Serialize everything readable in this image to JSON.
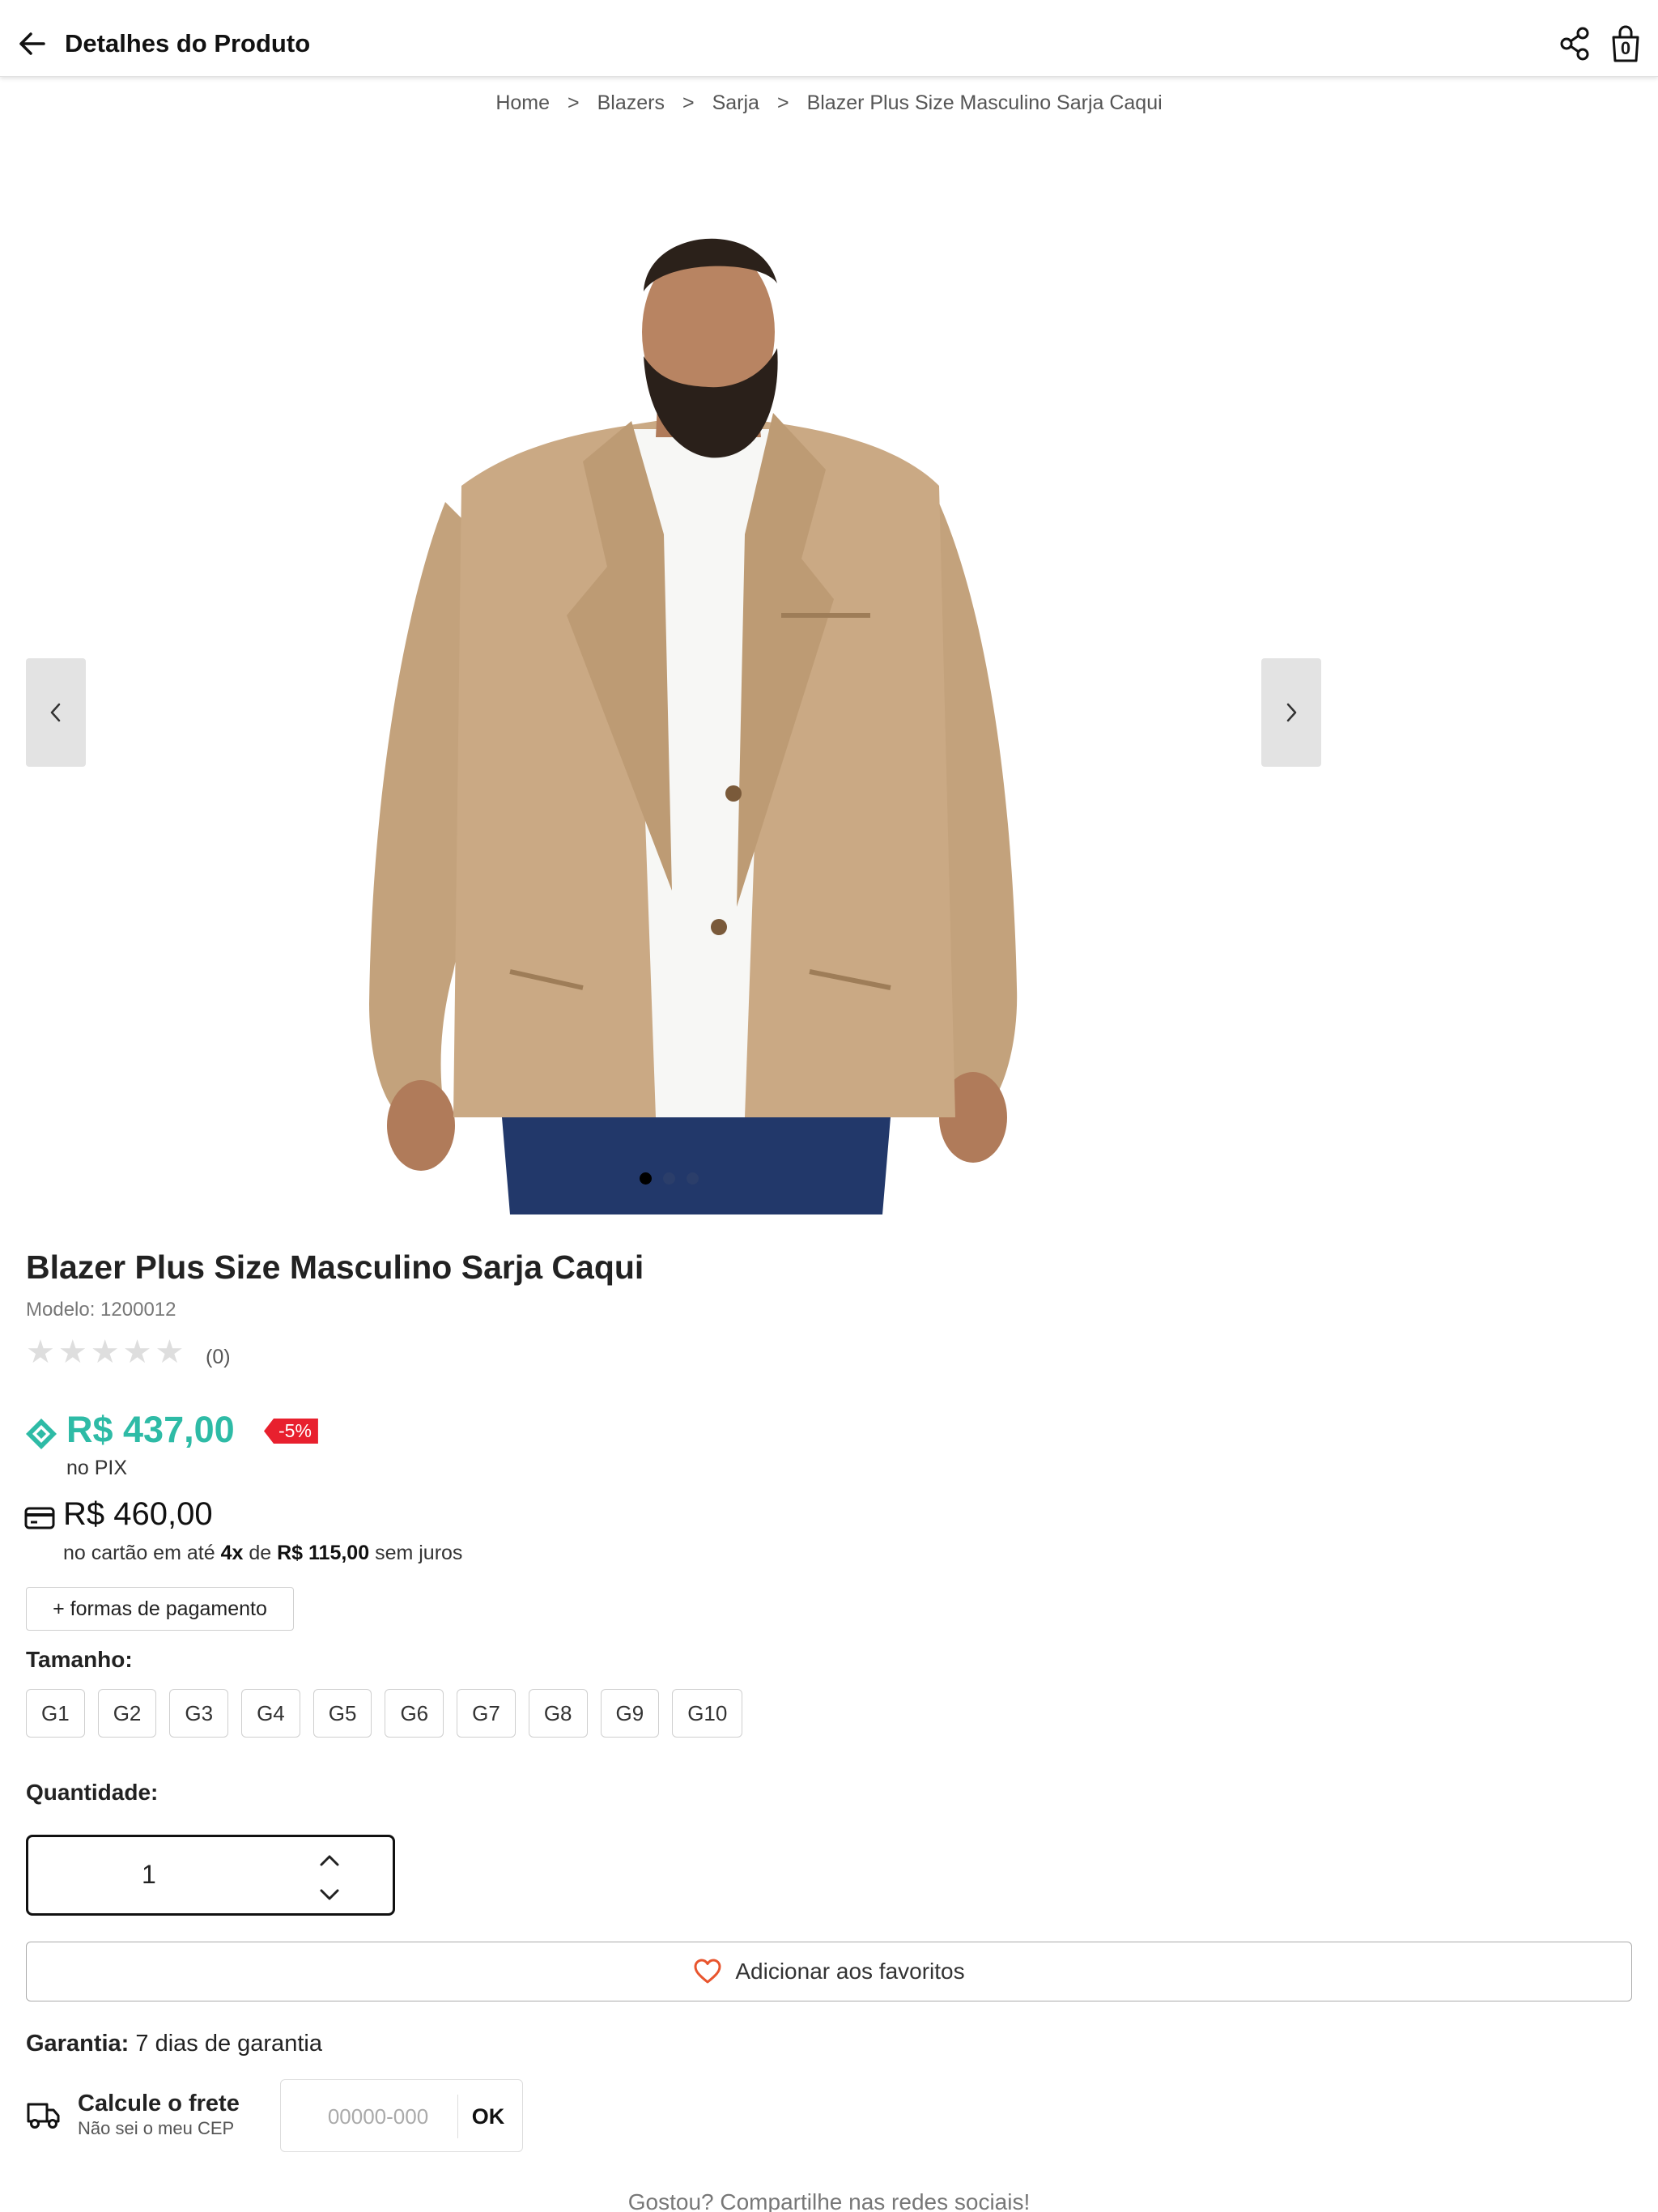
{
  "header": {
    "title": "Detalhes do Produto",
    "cart_count": "0"
  },
  "breadcrumb": {
    "items": [
      "Home",
      "Blazers",
      "Sarja",
      "Blazer Plus Size Masculino Sarja Caqui"
    ],
    "separator": ">"
  },
  "gallery": {
    "slide_count": 3,
    "active_slide": 1
  },
  "product": {
    "title": "Blazer Plus Size Masculino Sarja Caqui",
    "model": "Modelo: 1200012",
    "rating_stars": 0,
    "rating_max": 5,
    "rating_count": "(0)",
    "pix_price": "R$ 437,00",
    "discount": "-5%",
    "pix_label": "no PIX",
    "card_price": "R$ 460,00",
    "installments_prefix": "no cartão em até",
    "installments_count": "4x",
    "installments_mid": "de",
    "installments_value": "R$ 115,00",
    "installments_suffix": "sem juros"
  },
  "payment": {
    "more_label": "+ formas de pagamento"
  },
  "size": {
    "label": "Tamanho:",
    "options": [
      "G1",
      "G2",
      "G3",
      "G4",
      "G5",
      "G6",
      "G7",
      "G8",
      "G9",
      "G10"
    ]
  },
  "quantity": {
    "label": "Quantidade:",
    "value": "1"
  },
  "favorite": {
    "label": "Adicionar aos favoritos"
  },
  "warranty": {
    "label": "Garantia:",
    "value": "7 dias de garantia"
  },
  "shipping": {
    "title": "Calcule o frete",
    "cep_link": "Não sei o meu CEP",
    "placeholder": "00000-000",
    "ok_label": "OK"
  },
  "social": {
    "text": "Gostou? Compartilhe nas redes sociais!"
  },
  "colors": {
    "pix_green": "#2ebba6",
    "discount_red": "#e8202e",
    "heart_orange": "#e8552e"
  },
  "icons": {
    "back": "arrow-left-icon",
    "share": "share-icon",
    "cart": "shopping-bag-icon",
    "pix": "pix-icon",
    "card": "credit-card-icon",
    "heart": "heart-icon",
    "truck": "truck-icon"
  }
}
